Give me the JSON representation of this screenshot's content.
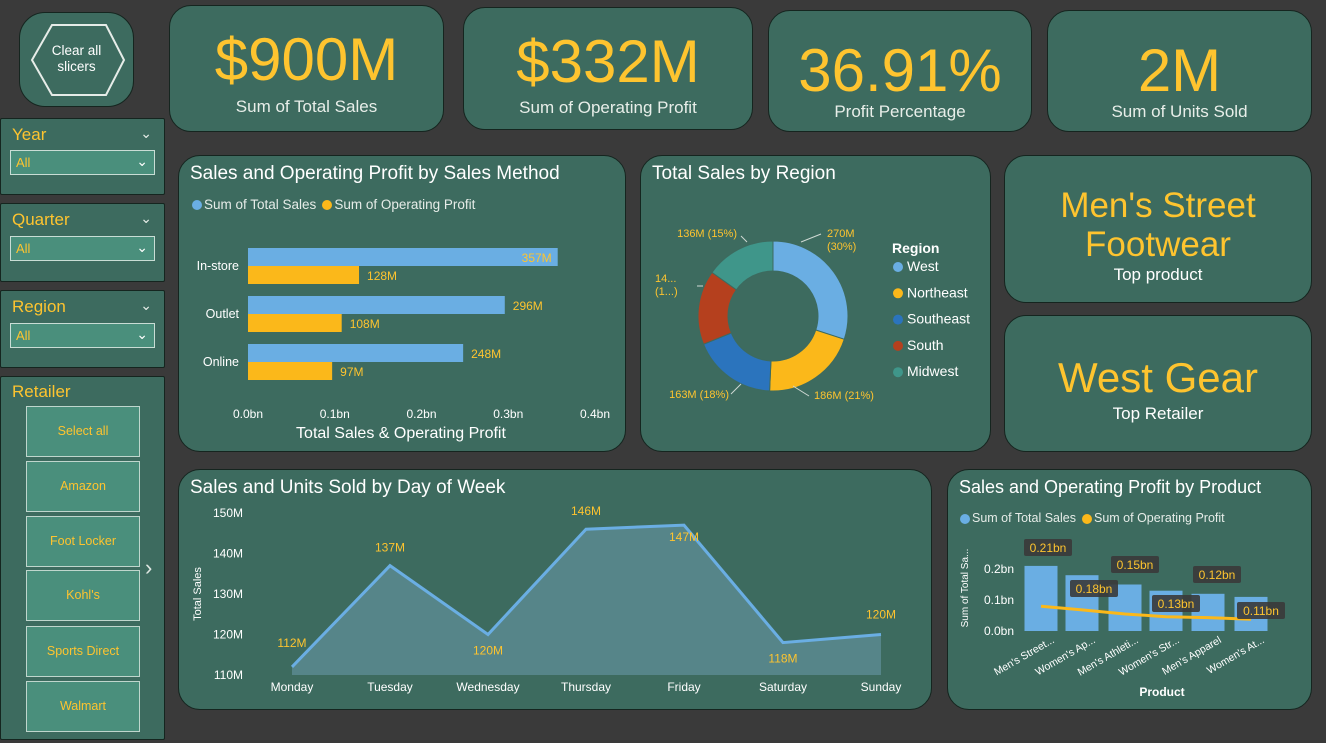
{
  "clear_button": {
    "label_line1": "Clear all",
    "label_line2": "slicers"
  },
  "kpis": [
    {
      "value": "$900M",
      "label": "Sum of Total Sales"
    },
    {
      "value": "$332M",
      "label": "Sum of Operating Profit"
    },
    {
      "value": "36.91%",
      "label": "Profit Percentage"
    },
    {
      "value": "2M",
      "label": "Sum of Units Sold"
    }
  ],
  "slicers": {
    "year": {
      "title": "Year",
      "value": "All"
    },
    "quarter": {
      "title": "Quarter",
      "value": "All"
    },
    "region": {
      "title": "Region",
      "value": "All"
    },
    "retailer": {
      "title": "Retailer",
      "items": [
        "Select all",
        "Amazon",
        "Foot Locker",
        "Kohl's",
        "Sports Direct",
        "Walmart"
      ]
    }
  },
  "top_product": {
    "value_line1": "Men's Street",
    "value_line2": "Footwear",
    "label": "Top product"
  },
  "top_retailer": {
    "value": "West Gear",
    "label": "Top Retailer"
  },
  "colors": {
    "blue": "#6aaee3",
    "yellow": "#fbb81a",
    "panel": "#3d6b5f",
    "accent": "#fec42f"
  },
  "chart_data": [
    {
      "type": "bar",
      "title": "Sales and Operating Profit by Sales Method",
      "xlabel": "Total Sales & Operating Profit",
      "categories": [
        "In-store",
        "Outlet",
        "Online"
      ],
      "series": [
        {
          "name": "Sum of Total Sales",
          "values": [
            357,
            296,
            248
          ],
          "labels": [
            "357M",
            "296M",
            "248M"
          ]
        },
        {
          "name": "Sum of Operating Profit",
          "values": [
            128,
            108,
            97
          ],
          "labels": [
            "128M",
            "108M",
            "97M"
          ]
        }
      ],
      "xlim": [
        0,
        400
      ],
      "xticks": [
        "0.0bn",
        "0.1bn",
        "0.2bn",
        "0.3bn",
        "0.4bn"
      ]
    },
    {
      "type": "pie",
      "title": "Total Sales by Region",
      "legend_title": "Region",
      "categories": [
        "West",
        "Northeast",
        "Southeast",
        "South",
        "Midwest"
      ],
      "values": [
        270,
        186,
        163,
        144,
        136
      ],
      "labels": [
        [
          "270M",
          "(30%)"
        ],
        [
          "186M (21%)"
        ],
        [
          "163M (18%)"
        ],
        [
          "14...",
          "(1...)"
        ],
        [
          "136M (15%)"
        ]
      ],
      "colors": [
        "#6aaee3",
        "#fbb81a",
        "#2b74bd",
        "#b5401e",
        "#3f968a"
      ]
    },
    {
      "type": "area",
      "title": "Sales and Units Sold by Day of Week",
      "ylabel": "Total Sales",
      "categories": [
        "Monday",
        "Tuesday",
        "Wednesday",
        "Thursday",
        "Friday",
        "Saturday",
        "Sunday"
      ],
      "values": [
        112,
        137,
        120,
        146,
        147,
        118,
        120
      ],
      "labels": [
        "112M",
        "137M",
        "120M",
        "146M",
        "147M",
        "118M",
        "120M"
      ],
      "ylim": [
        110,
        150
      ],
      "yticks": [
        "110M",
        "120M",
        "130M",
        "140M",
        "150M"
      ]
    },
    {
      "type": "bar",
      "title": "Sales and Operating Profit by Product",
      "xlabel": "Product",
      "ylabel": "Sum of Total Sa...",
      "categories": [
        "Men's Street...",
        "Women's Ap...",
        "Men's Athleti...",
        "Women's Str...",
        "Men's Apparel",
        "Women's At..."
      ],
      "series": [
        {
          "name": "Sum of Total Sales",
          "values": [
            0.21,
            0.18,
            0.15,
            0.13,
            0.12,
            0.11
          ],
          "labels": [
            "0.21bn",
            "0.18bn",
            "0.15bn",
            "0.13bn",
            "0.12bn",
            "0.11bn"
          ]
        },
        {
          "name": "Sum of Operating Profit",
          "values": [
            0.08,
            0.068,
            0.055,
            0.046,
            0.043,
            0.038
          ]
        }
      ],
      "ylim": [
        0,
        0.25
      ],
      "yticks": [
        "0.0bn",
        "0.1bn",
        "0.2bn"
      ]
    }
  ]
}
